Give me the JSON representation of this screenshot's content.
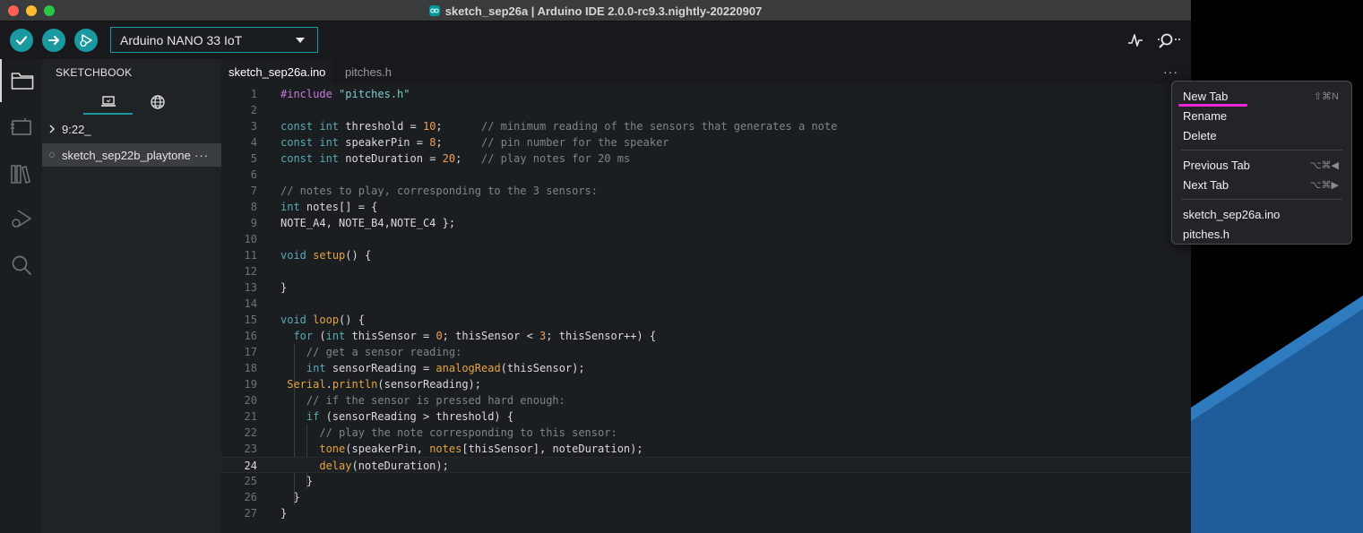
{
  "window": {
    "title": "sketch_sep26a | Arduino IDE 2.0.0-rc9.3.nightly-20220907"
  },
  "toolbar": {
    "verify_icon": "check-icon",
    "upload_icon": "arrow-right-icon",
    "debug_icon": "debug-icon",
    "board": "Arduino NANO 33 IoT",
    "serial_plotter_icon": "pulse-icon",
    "serial_monitor_icon": "magnifier-icon"
  },
  "sidebar": {
    "title": "SKETCHBOOK",
    "tabs": [
      {
        "icon": "laptop-icon"
      },
      {
        "icon": "globe-icon"
      }
    ],
    "items": [
      {
        "label": "9:22_",
        "type": "folder"
      },
      {
        "label": "sketch_sep22b_playtone",
        "more": "···",
        "selected": true
      }
    ]
  },
  "editor": {
    "tabs": [
      {
        "label": "sketch_sep26a.ino",
        "active": true
      },
      {
        "label": "pitches.h",
        "active": false
      }
    ],
    "more": "···",
    "current_line": 24,
    "lines": [
      {
        "n": "1"
      },
      {
        "n": "2"
      },
      {
        "n": "3"
      },
      {
        "n": "4"
      },
      {
        "n": "5"
      },
      {
        "n": "6"
      },
      {
        "n": "7"
      },
      {
        "n": "8"
      },
      {
        "n": "9"
      },
      {
        "n": "10"
      },
      {
        "n": "11"
      },
      {
        "n": "12"
      },
      {
        "n": "13"
      },
      {
        "n": "14"
      },
      {
        "n": "15"
      },
      {
        "n": "16"
      },
      {
        "n": "17"
      },
      {
        "n": "18"
      },
      {
        "n": "19"
      },
      {
        "n": "20"
      },
      {
        "n": "21"
      },
      {
        "n": "22"
      },
      {
        "n": "23"
      },
      {
        "n": "24"
      },
      {
        "n": "25"
      },
      {
        "n": "26"
      },
      {
        "n": "27"
      }
    ],
    "code": {
      "l1": {
        "a": "#include",
        "b": " ",
        "c": "\"pitches.h\""
      },
      "l3": {
        "a": "const",
        "b": " ",
        "c": "int",
        "d": " threshold = ",
        "e": "10",
        "f": ";",
        "g": "      // minimum reading of the sensors that generates a note"
      },
      "l4": {
        "a": "const",
        "b": " ",
        "c": "int",
        "d": " speakerPin = ",
        "e": "8",
        "f": ";",
        "g": "      // pin number for the speaker"
      },
      "l5": {
        "a": "const",
        "b": " ",
        "c": "int",
        "d": " noteDuration = ",
        "e": "20",
        "f": ";",
        "g": "   // play notes for 20 ms"
      },
      "l7": {
        "a": "// notes to play, corresponding to the 3 sensors:"
      },
      "l8": {
        "a": "int",
        "b": " notes[] = {"
      },
      "l9": {
        "a": "NOTE_A4, NOTE_B4,NOTE_C4 };"
      },
      "l11": {
        "a": "void",
        "b": " ",
        "c": "setup",
        "d": "() {"
      },
      "l13": {
        "a": "}"
      },
      "l15": {
        "a": "void",
        "b": " ",
        "c": "loop",
        "d": "() {"
      },
      "l16": {
        "a": "  ",
        "b": "for",
        "c": " (",
        "d": "int",
        "e": " thisSensor = ",
        "f": "0",
        "g": "; thisSensor < ",
        "h": "3",
        "i": "; thisSensor++) {"
      },
      "l17": {
        "a": "    // get a sensor reading:"
      },
      "l18": {
        "a": "    ",
        "b": "int",
        "c": " sensorReading = ",
        "d": "analogRead",
        "e": "(thisSensor);"
      },
      "l19": {
        "a": " ",
        "b": "Serial",
        "c": ".",
        "d": "println",
        "e": "(sensorReading);"
      },
      "l20": {
        "a": "    // if the sensor is pressed hard enough:"
      },
      "l21": {
        "a": "    ",
        "b": "if",
        "c": " (sensorReading > threshold) {"
      },
      "l22": {
        "a": "      // play the note corresponding to this sensor:"
      },
      "l23": {
        "a": "      ",
        "b": "tone",
        "c": "(speakerPin, ",
        "d": "notes",
        "e": "[thisSensor], noteDuration);"
      },
      "l24": {
        "a": "      ",
        "b": "delay",
        "c": "(noteDuration);"
      },
      "l25": {
        "a": "    }"
      },
      "l26": {
        "a": "  }"
      },
      "l27": {
        "a": "}"
      }
    }
  },
  "context_menu": {
    "items": [
      {
        "label": "New Tab",
        "shortcut": "⇧⌘N"
      },
      {
        "label": "Rename"
      },
      {
        "label": "Delete"
      },
      {
        "label": "Previous Tab",
        "shortcut": "⌥⌘◀"
      },
      {
        "label": "Next Tab",
        "shortcut": "⌥⌘▶"
      },
      {
        "label": "sketch_sep26a.ino"
      },
      {
        "label": "pitches.h"
      }
    ],
    "annotation_color": "#ee27d8"
  },
  "colors": {
    "accent": "#1a9aa0",
    "editor_bg": "#1b1e21",
    "sidebar_bg": "#202326"
  }
}
